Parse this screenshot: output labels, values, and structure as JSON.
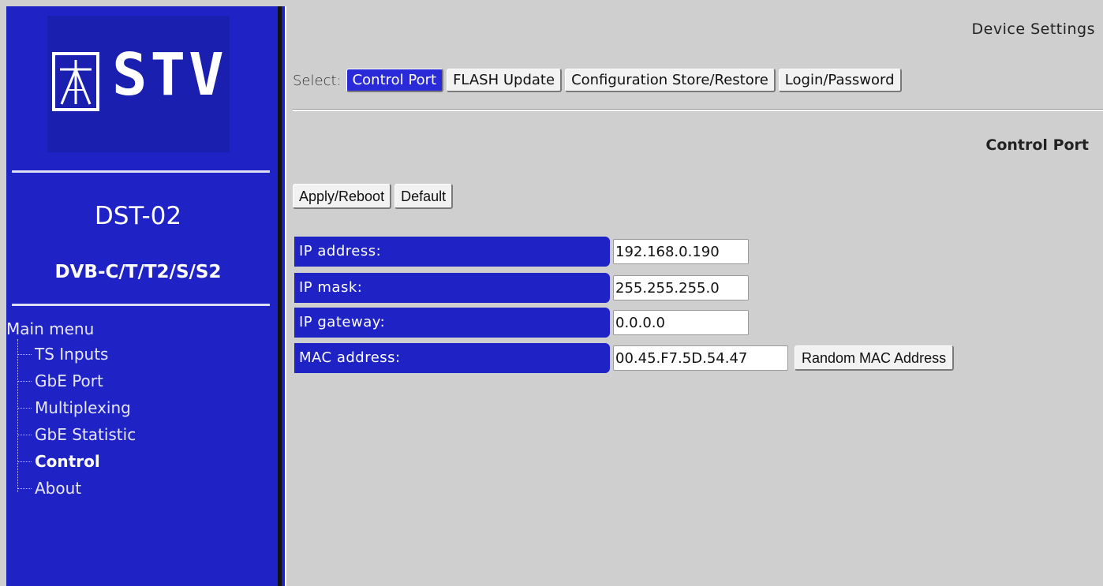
{
  "sidebar": {
    "logo_text": "STV",
    "device_name": "DST-02",
    "device_type": "DVB-C/T/T2/S/S2",
    "menu_title": "Main menu",
    "menu_items": [
      {
        "label": "TS Inputs",
        "active": false
      },
      {
        "label": "GbE Port",
        "active": false
      },
      {
        "label": "Multiplexing",
        "active": false
      },
      {
        "label": "GbE Statistic",
        "active": false
      },
      {
        "label": "Control",
        "active": true
      },
      {
        "label": "About",
        "active": false
      }
    ]
  },
  "header": {
    "title": "Device Settings",
    "select_label": "Select:",
    "tabs": [
      {
        "label": "Control Port",
        "active": true
      },
      {
        "label": "FLASH Update",
        "active": false
      },
      {
        "label": "Configuration Store/Restore",
        "active": false
      },
      {
        "label": "Login/Password",
        "active": false
      }
    ]
  },
  "main": {
    "section_title": "Control Port",
    "apply_label": "Apply/Reboot",
    "default_label": "Default",
    "fields": [
      {
        "label": "IP address:",
        "value": "192.168.0.190"
      },
      {
        "label": "IP mask:",
        "value": "255.255.255.0"
      },
      {
        "label": "IP gateway:",
        "value": "0.0.0.0"
      },
      {
        "label": "MAC address:",
        "value": "00.45.F7.5D.54.47"
      }
    ],
    "random_mac_label": "Random MAC Address"
  },
  "colors": {
    "sidebar_blue": "#1f22c4",
    "active_tab_blue": "#2a2ad8",
    "background_gray": "#cfcfcf"
  }
}
